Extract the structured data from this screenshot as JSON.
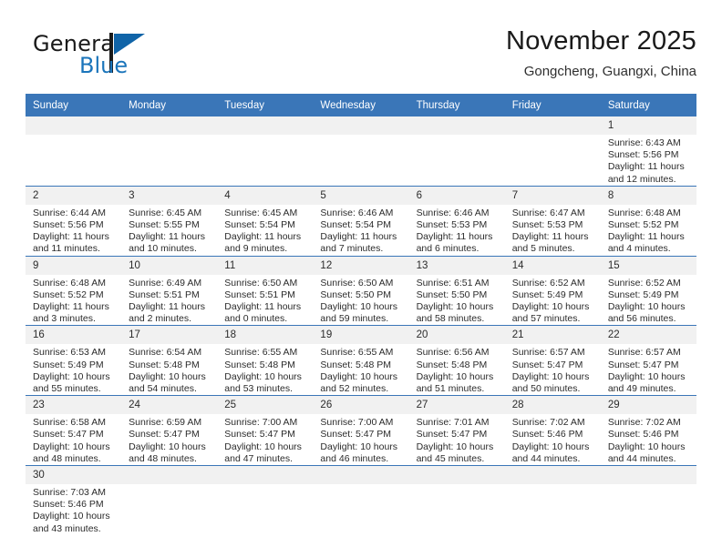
{
  "brand": {
    "name_top": "General",
    "name_bottom": "Blue",
    "triangle_icon": "triangle-logo-icon",
    "color_blue": "#1b75bb",
    "color_triangle": "#1064a8"
  },
  "header": {
    "title": "November 2025",
    "subtitle": "Gongcheng, Guangxi, China"
  },
  "theme": {
    "header_bg": "#3a76b8",
    "daynum_bg": "#f1f1f1",
    "grid_line": "#3a76b8"
  },
  "calendar": {
    "weekday_headers": [
      "Sunday",
      "Monday",
      "Tuesday",
      "Wednesday",
      "Thursday",
      "Friday",
      "Saturday"
    ],
    "labels": {
      "sunrise": "Sunrise:",
      "sunset": "Sunset:",
      "daylight": "Daylight:"
    },
    "weeks": [
      [
        {
          "blank": true
        },
        {
          "blank": true
        },
        {
          "blank": true
        },
        {
          "blank": true
        },
        {
          "blank": true
        },
        {
          "blank": true
        },
        {
          "day": "1",
          "sunrise": "Sunrise: 6:43 AM",
          "sunset": "Sunset: 5:56 PM",
          "daylight": "Daylight: 11 hours and 12 minutes."
        }
      ],
      [
        {
          "day": "2",
          "sunrise": "Sunrise: 6:44 AM",
          "sunset": "Sunset: 5:56 PM",
          "daylight": "Daylight: 11 hours and 11 minutes."
        },
        {
          "day": "3",
          "sunrise": "Sunrise: 6:45 AM",
          "sunset": "Sunset: 5:55 PM",
          "daylight": "Daylight: 11 hours and 10 minutes."
        },
        {
          "day": "4",
          "sunrise": "Sunrise: 6:45 AM",
          "sunset": "Sunset: 5:54 PM",
          "daylight": "Daylight: 11 hours and 9 minutes."
        },
        {
          "day": "5",
          "sunrise": "Sunrise: 6:46 AM",
          "sunset": "Sunset: 5:54 PM",
          "daylight": "Daylight: 11 hours and 7 minutes."
        },
        {
          "day": "6",
          "sunrise": "Sunrise: 6:46 AM",
          "sunset": "Sunset: 5:53 PM",
          "daylight": "Daylight: 11 hours and 6 minutes."
        },
        {
          "day": "7",
          "sunrise": "Sunrise: 6:47 AM",
          "sunset": "Sunset: 5:53 PM",
          "daylight": "Daylight: 11 hours and 5 minutes."
        },
        {
          "day": "8",
          "sunrise": "Sunrise: 6:48 AM",
          "sunset": "Sunset: 5:52 PM",
          "daylight": "Daylight: 11 hours and 4 minutes."
        }
      ],
      [
        {
          "day": "9",
          "sunrise": "Sunrise: 6:48 AM",
          "sunset": "Sunset: 5:52 PM",
          "daylight": "Daylight: 11 hours and 3 minutes."
        },
        {
          "day": "10",
          "sunrise": "Sunrise: 6:49 AM",
          "sunset": "Sunset: 5:51 PM",
          "daylight": "Daylight: 11 hours and 2 minutes."
        },
        {
          "day": "11",
          "sunrise": "Sunrise: 6:50 AM",
          "sunset": "Sunset: 5:51 PM",
          "daylight": "Daylight: 11 hours and 0 minutes."
        },
        {
          "day": "12",
          "sunrise": "Sunrise: 6:50 AM",
          "sunset": "Sunset: 5:50 PM",
          "daylight": "Daylight: 10 hours and 59 minutes."
        },
        {
          "day": "13",
          "sunrise": "Sunrise: 6:51 AM",
          "sunset": "Sunset: 5:50 PM",
          "daylight": "Daylight: 10 hours and 58 minutes."
        },
        {
          "day": "14",
          "sunrise": "Sunrise: 6:52 AM",
          "sunset": "Sunset: 5:49 PM",
          "daylight": "Daylight: 10 hours and 57 minutes."
        },
        {
          "day": "15",
          "sunrise": "Sunrise: 6:52 AM",
          "sunset": "Sunset: 5:49 PM",
          "daylight": "Daylight: 10 hours and 56 minutes."
        }
      ],
      [
        {
          "day": "16",
          "sunrise": "Sunrise: 6:53 AM",
          "sunset": "Sunset: 5:49 PM",
          "daylight": "Daylight: 10 hours and 55 minutes."
        },
        {
          "day": "17",
          "sunrise": "Sunrise: 6:54 AM",
          "sunset": "Sunset: 5:48 PM",
          "daylight": "Daylight: 10 hours and 54 minutes."
        },
        {
          "day": "18",
          "sunrise": "Sunrise: 6:55 AM",
          "sunset": "Sunset: 5:48 PM",
          "daylight": "Daylight: 10 hours and 53 minutes."
        },
        {
          "day": "19",
          "sunrise": "Sunrise: 6:55 AM",
          "sunset": "Sunset: 5:48 PM",
          "daylight": "Daylight: 10 hours and 52 minutes."
        },
        {
          "day": "20",
          "sunrise": "Sunrise: 6:56 AM",
          "sunset": "Sunset: 5:48 PM",
          "daylight": "Daylight: 10 hours and 51 minutes."
        },
        {
          "day": "21",
          "sunrise": "Sunrise: 6:57 AM",
          "sunset": "Sunset: 5:47 PM",
          "daylight": "Daylight: 10 hours and 50 minutes."
        },
        {
          "day": "22",
          "sunrise": "Sunrise: 6:57 AM",
          "sunset": "Sunset: 5:47 PM",
          "daylight": "Daylight: 10 hours and 49 minutes."
        }
      ],
      [
        {
          "day": "23",
          "sunrise": "Sunrise: 6:58 AM",
          "sunset": "Sunset: 5:47 PM",
          "daylight": "Daylight: 10 hours and 48 minutes."
        },
        {
          "day": "24",
          "sunrise": "Sunrise: 6:59 AM",
          "sunset": "Sunset: 5:47 PM",
          "daylight": "Daylight: 10 hours and 48 minutes."
        },
        {
          "day": "25",
          "sunrise": "Sunrise: 7:00 AM",
          "sunset": "Sunset: 5:47 PM",
          "daylight": "Daylight: 10 hours and 47 minutes."
        },
        {
          "day": "26",
          "sunrise": "Sunrise: 7:00 AM",
          "sunset": "Sunset: 5:47 PM",
          "daylight": "Daylight: 10 hours and 46 minutes."
        },
        {
          "day": "27",
          "sunrise": "Sunrise: 7:01 AM",
          "sunset": "Sunset: 5:47 PM",
          "daylight": "Daylight: 10 hours and 45 minutes."
        },
        {
          "day": "28",
          "sunrise": "Sunrise: 7:02 AM",
          "sunset": "Sunset: 5:46 PM",
          "daylight": "Daylight: 10 hours and 44 minutes."
        },
        {
          "day": "29",
          "sunrise": "Sunrise: 7:02 AM",
          "sunset": "Sunset: 5:46 PM",
          "daylight": "Daylight: 10 hours and 44 minutes."
        }
      ],
      [
        {
          "day": "30",
          "sunrise": "Sunrise: 7:03 AM",
          "sunset": "Sunset: 5:46 PM",
          "daylight": "Daylight: 10 hours and 43 minutes."
        },
        {
          "blank": true
        },
        {
          "blank": true
        },
        {
          "blank": true
        },
        {
          "blank": true
        },
        {
          "blank": true
        },
        {
          "blank": true
        }
      ]
    ]
  }
}
